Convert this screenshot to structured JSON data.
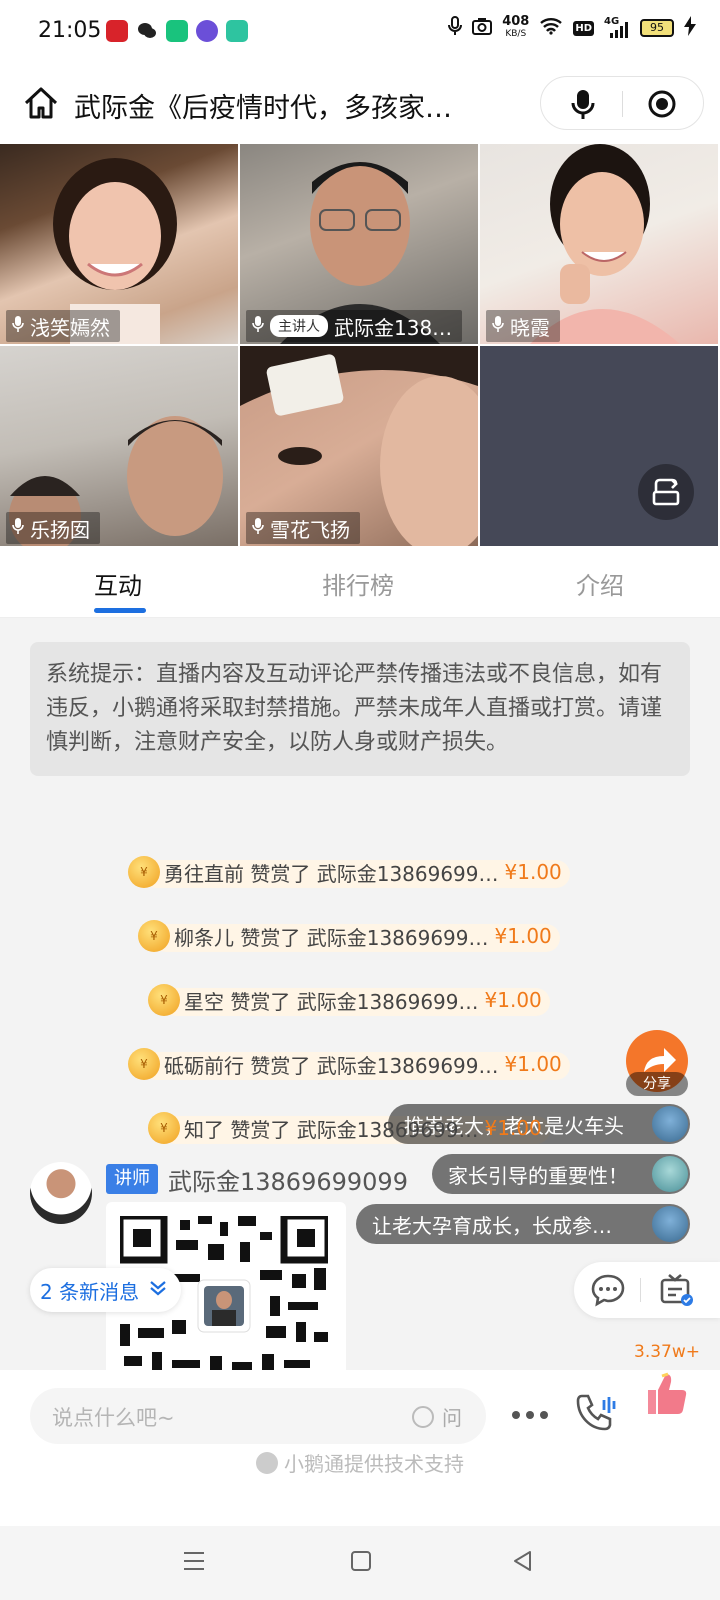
{
  "status_bar": {
    "time": "21:05",
    "net_speed_value": "408",
    "net_speed_unit": "KB/S",
    "signal_label": "4G",
    "hd_label": "HD",
    "battery": "95"
  },
  "header": {
    "title": "武际金《后疫情时代，多孩家…"
  },
  "video_tiles": [
    {
      "name": "浅笑嫣然"
    },
    {
      "badge": "主讲人",
      "name": "武际金138…"
    },
    {
      "name": "晓霞"
    },
    {
      "name": "乐扬囡"
    },
    {
      "name": "雪花飞扬"
    }
  ],
  "tabs": [
    {
      "label": "互动"
    },
    {
      "label": "排行榜"
    },
    {
      "label": "介绍"
    }
  ],
  "system_notice": "系统提示：直播内容及互动评论严禁传播违法或不良信息，如有违反，小鹅通将采取封禁措施。严禁未成年人直播或打赏。请谨慎判断，注意财产安全，以防人身或财产损失。",
  "rewards": [
    {
      "text": "勇往直前 赞赏了 武际金13869699…",
      "amount": "¥1.00"
    },
    {
      "text": "柳条儿 赞赏了 武际金13869699…",
      "amount": "¥1.00"
    },
    {
      "text": "星空 赞赏了 武际金13869699…",
      "amount": "¥1.00"
    },
    {
      "text": "砥砺前行 赞赏了 武际金13869699…",
      "amount": "¥1.00"
    },
    {
      "text": "知了 赞赏了 武际金13869699…",
      "amount": "¥1.00"
    }
  ],
  "coin_symbol": "¥",
  "share_label": "分享",
  "bubbles": [
    {
      "text": "推崇老大，老大是火车头"
    },
    {
      "text": "家长引导的重要性！"
    },
    {
      "text": "让老大孕育成长，长成参…"
    }
  ],
  "message": {
    "role_tag": "讲师",
    "sender": "武际金13869699099"
  },
  "new_messages": "2 条新消息",
  "input": {
    "placeholder": "说点什么吧~",
    "ask_label": "问"
  },
  "like_count": "3.37w+",
  "footer_credit": "小鹅通提供技术支持",
  "colors": {
    "accent": "#1d6fe0",
    "reward_amount": "#f07a1a",
    "share_button": "#f4762a",
    "like_button": "#f27a8a"
  }
}
